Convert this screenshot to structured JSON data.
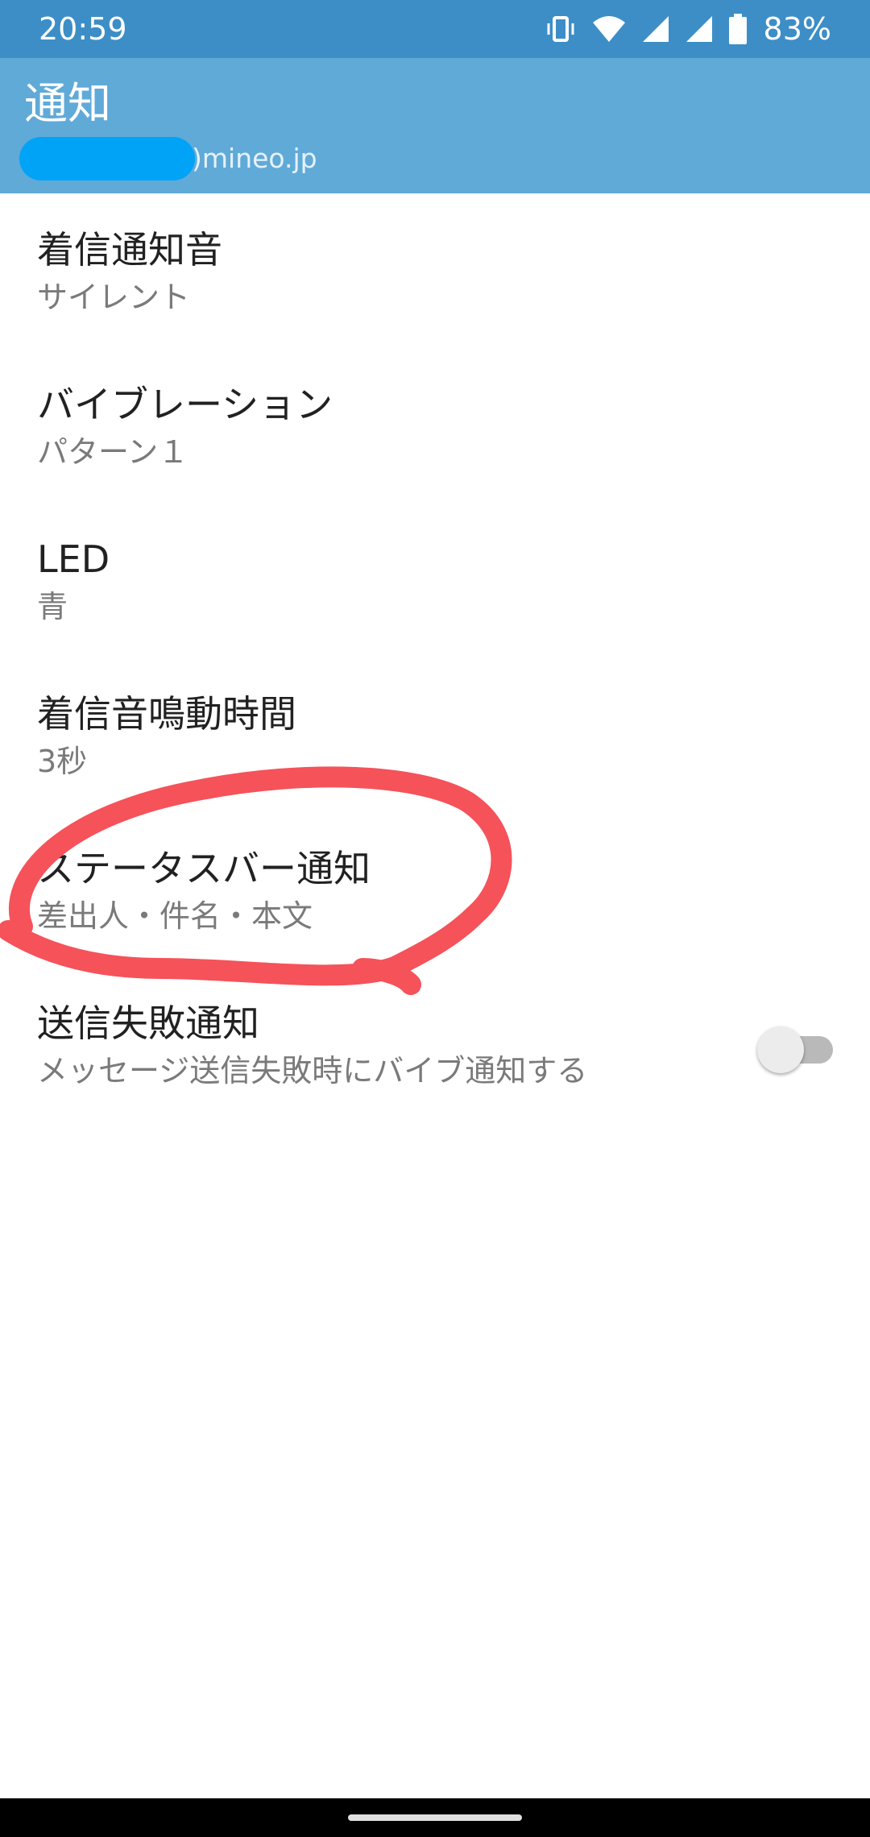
{
  "status_bar": {
    "time": "20:59",
    "battery_percent": "83%",
    "icons": [
      "vibrate-icon",
      "wifi-icon",
      "signal-icon",
      "signal-icon",
      "battery-icon"
    ]
  },
  "app_bar": {
    "title": "通知",
    "subtitle_suffix": ")mineo.jp"
  },
  "settings": [
    {
      "title": "着信通知音",
      "summary": "サイレント"
    },
    {
      "title": "バイブレーション",
      "summary": "パターン１"
    },
    {
      "title": "LED",
      "summary": "青"
    },
    {
      "title": "着信音鳴動時間",
      "summary": "3秒"
    },
    {
      "title": "ステータスバー通知",
      "summary": "差出人・件名・本文"
    },
    {
      "title": "送信失敗通知",
      "summary": "メッセージ送信失敗時にバイブ通知する",
      "toggle_on": false
    }
  ],
  "colors": {
    "status_bar": "#3d8ec6",
    "app_bar": "#60aad8",
    "redaction": "#00a3f5",
    "annotation": "#f5525a"
  }
}
